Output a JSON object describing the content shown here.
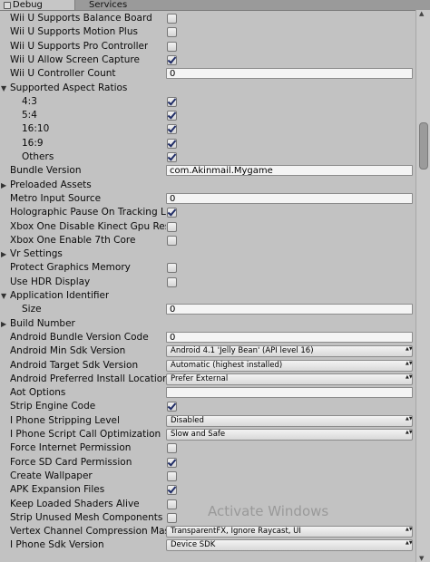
{
  "tabs": [
    {
      "label": "Debug",
      "active": true
    },
    {
      "label": "Services",
      "active": false
    }
  ],
  "rows": [
    {
      "label": "Wii U Supports Balance Board",
      "indent": 0,
      "control": "checkbox",
      "checked": false,
      "fold": "none"
    },
    {
      "label": "Wii U Supports Motion Plus",
      "indent": 0,
      "control": "checkbox",
      "checked": false,
      "fold": "none"
    },
    {
      "label": "Wii U Supports Pro Controller",
      "indent": 0,
      "control": "checkbox",
      "checked": false,
      "fold": "none"
    },
    {
      "label": "Wii U Allow Screen Capture",
      "indent": 0,
      "control": "checkbox",
      "checked": true,
      "fold": "none"
    },
    {
      "label": "Wii U Controller Count",
      "indent": 0,
      "control": "text",
      "value": "0",
      "fold": "none"
    },
    {
      "label": "Supported Aspect Ratios",
      "indent": 0,
      "control": "none",
      "fold": "open"
    },
    {
      "label": "4:3",
      "indent": 1,
      "control": "checkbox",
      "checked": true,
      "fold": "none"
    },
    {
      "label": "5:4",
      "indent": 1,
      "control": "checkbox",
      "checked": true,
      "fold": "none"
    },
    {
      "label": "16:10",
      "indent": 1,
      "control": "checkbox",
      "checked": true,
      "fold": "none"
    },
    {
      "label": "16:9",
      "indent": 1,
      "control": "checkbox",
      "checked": true,
      "fold": "none"
    },
    {
      "label": "Others",
      "indent": 1,
      "control": "checkbox",
      "checked": true,
      "fold": "none"
    },
    {
      "label": "Bundle Version",
      "indent": 0,
      "control": "text",
      "value": "com.Akinmail.Mygame",
      "fold": "none"
    },
    {
      "label": "Preloaded Assets",
      "indent": 0,
      "control": "none",
      "fold": "closed"
    },
    {
      "label": "Metro Input Source",
      "indent": 0,
      "control": "text",
      "value": "0",
      "fold": "none"
    },
    {
      "label": "Holographic Pause On Tracking Loss",
      "indent": 0,
      "control": "checkbox",
      "checked": true,
      "fold": "none"
    },
    {
      "label": "Xbox One Disable Kinect Gpu Reservation",
      "indent": 0,
      "control": "checkbox",
      "checked": false,
      "fold": "none"
    },
    {
      "label": "Xbox One Enable 7th Core",
      "indent": 0,
      "control": "checkbox",
      "checked": false,
      "fold": "none"
    },
    {
      "label": "Vr Settings",
      "indent": 0,
      "control": "none",
      "fold": "closed"
    },
    {
      "label": "Protect Graphics Memory",
      "indent": 0,
      "control": "checkbox",
      "checked": false,
      "fold": "none"
    },
    {
      "label": "Use HDR Display",
      "indent": 0,
      "control": "checkbox",
      "checked": false,
      "fold": "none"
    },
    {
      "label": "Application Identifier",
      "indent": 0,
      "control": "none",
      "fold": "open"
    },
    {
      "label": "Size",
      "indent": 1,
      "control": "text",
      "value": "0",
      "fold": "none"
    },
    {
      "label": "Build Number",
      "indent": 0,
      "control": "none",
      "fold": "closed"
    },
    {
      "label": "Android Bundle Version Code",
      "indent": 0,
      "control": "text",
      "value": "0",
      "fold": "none"
    },
    {
      "label": "Android Min Sdk Version",
      "indent": 0,
      "control": "dropdown",
      "value": "Android 4.1 'Jelly Bean' (API level 16)",
      "fold": "none"
    },
    {
      "label": "Android Target Sdk Version",
      "indent": 0,
      "control": "dropdown",
      "value": "Automatic (highest installed)",
      "fold": "none"
    },
    {
      "label": "Android Preferred Install Location",
      "indent": 0,
      "control": "dropdown",
      "value": "Prefer External",
      "fold": "none"
    },
    {
      "label": "Aot Options",
      "indent": 0,
      "control": "text",
      "value": "",
      "fold": "none"
    },
    {
      "label": "Strip Engine Code",
      "indent": 0,
      "control": "checkbox",
      "checked": true,
      "fold": "none"
    },
    {
      "label": "I Phone Stripping Level",
      "indent": 0,
      "control": "dropdown",
      "value": "Disabled",
      "fold": "none"
    },
    {
      "label": "I Phone Script Call Optimization",
      "indent": 0,
      "control": "dropdown",
      "value": "Slow and Safe",
      "fold": "none"
    },
    {
      "label": "Force Internet Permission",
      "indent": 0,
      "control": "checkbox",
      "checked": false,
      "fold": "none"
    },
    {
      "label": "Force SD Card Permission",
      "indent": 0,
      "control": "checkbox",
      "checked": true,
      "fold": "none"
    },
    {
      "label": "Create Wallpaper",
      "indent": 0,
      "control": "checkbox",
      "checked": false,
      "fold": "none"
    },
    {
      "label": "APK Expansion Files",
      "indent": 0,
      "control": "checkbox",
      "checked": true,
      "fold": "none"
    },
    {
      "label": "Keep Loaded Shaders Alive",
      "indent": 0,
      "control": "checkbox",
      "checked": false,
      "fold": "none"
    },
    {
      "label": "Strip Unused Mesh Components",
      "indent": 0,
      "control": "checkbox",
      "checked": false,
      "fold": "none"
    },
    {
      "label": "Vertex Channel Compression Mask",
      "indent": 0,
      "control": "dropdown",
      "value": "TransparentFX, Ignore Raycast, UI",
      "fold": "none"
    },
    {
      "label": "I Phone Sdk Version",
      "indent": 0,
      "control": "dropdown",
      "value": "Device SDK",
      "fold": "none"
    }
  ],
  "watermark": "Activate Windows",
  "icons": {
    "fold_open": "triangle-down-icon",
    "fold_closed": "triangle-right-icon",
    "dropdown": "dropdown-caret-icon"
  }
}
